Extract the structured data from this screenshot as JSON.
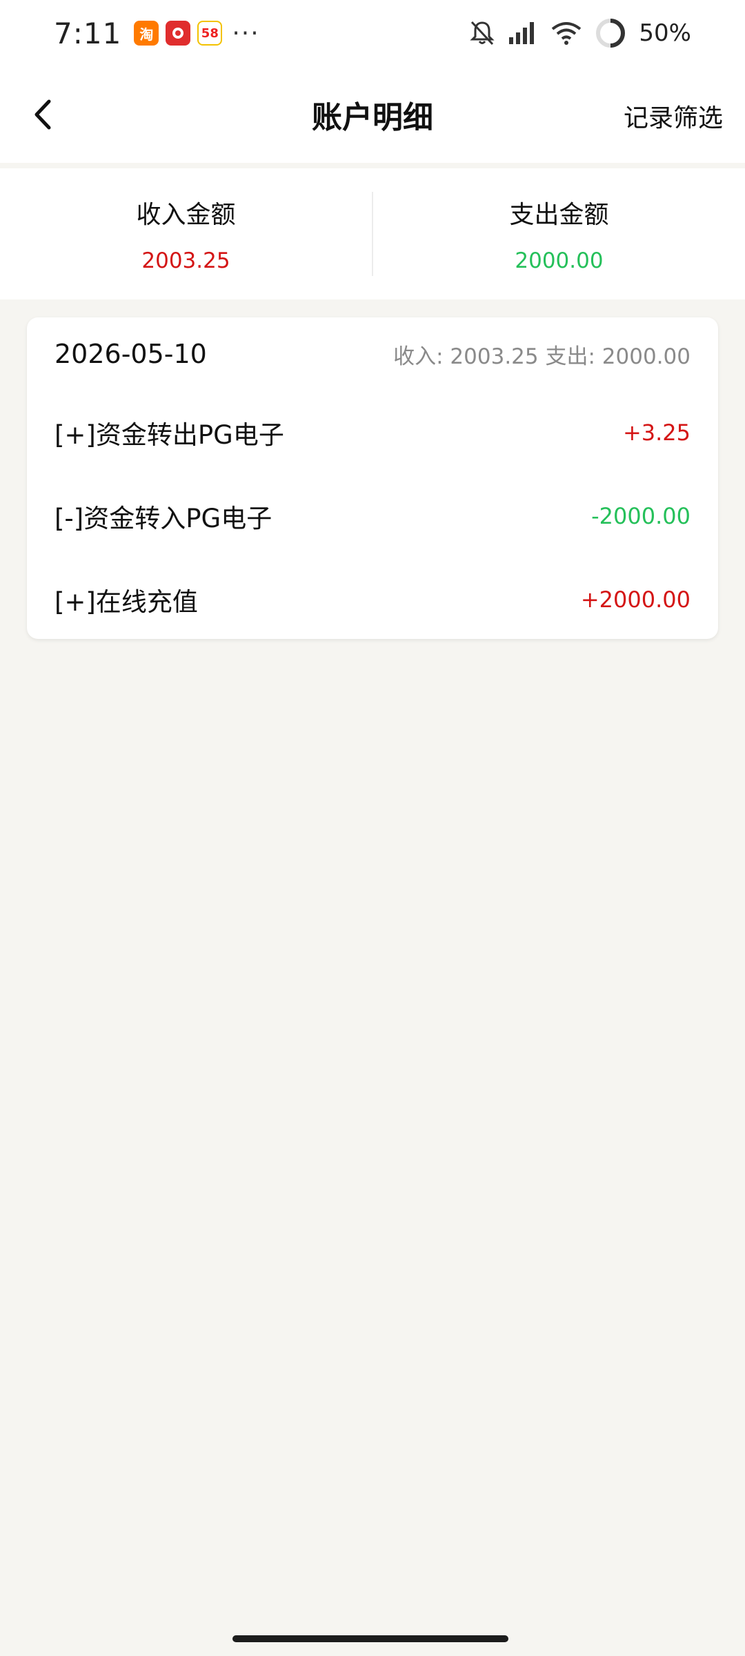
{
  "status_bar": {
    "time": "7:11",
    "notif_apps": [
      {
        "name": "淘",
        "color": "#ff7a00"
      },
      {
        "name": "",
        "color": "#e02d2d"
      },
      {
        "name": "58",
        "color": "#f3c200"
      }
    ],
    "more": "···",
    "battery": "50%"
  },
  "header": {
    "title": "账户明细",
    "filter_label": "记录筛选"
  },
  "summary": {
    "income_label": "收入金额",
    "income_value": "2003.25",
    "expense_label": "支出金额",
    "expense_value": "2000.00"
  },
  "day_group": {
    "date": "2026-05-10",
    "income_prefix": "收入:",
    "income_total": "2003.25",
    "expense_prefix": "支出:",
    "expense_total": "2000.00",
    "transactions": [
      {
        "label": "[+]资金转出PG电子",
        "amount": "+3.25",
        "type": "income"
      },
      {
        "label": "[-]资金转入PG电子",
        "amount": "-2000.00",
        "type": "expense"
      },
      {
        "label": "[+]在线充值",
        "amount": "+2000.00",
        "type": "income"
      }
    ]
  },
  "colors": {
    "income": "#d41515",
    "expense": "#25c05a",
    "background": "#f6f5f1"
  }
}
